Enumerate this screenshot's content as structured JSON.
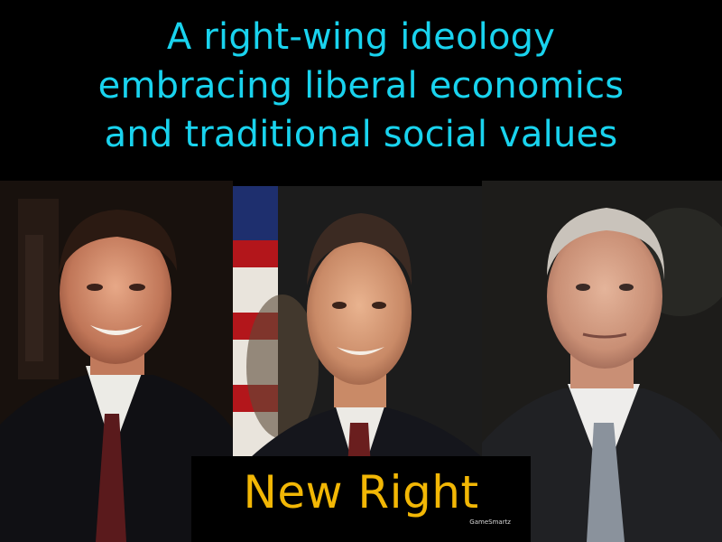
{
  "definition": {
    "lines": [
      "A right-wing ideology",
      "embracing liberal economics",
      "and traditional social values"
    ]
  },
  "term": "New Right",
  "watermark": "GameSmartz",
  "photos": [
    {
      "name": "portrait-left"
    },
    {
      "name": "portrait-middle"
    },
    {
      "name": "portrait-right"
    }
  ],
  "colors": {
    "definition_text": "#19d3ee",
    "term_text": "#f2b705",
    "background": "#000000"
  }
}
